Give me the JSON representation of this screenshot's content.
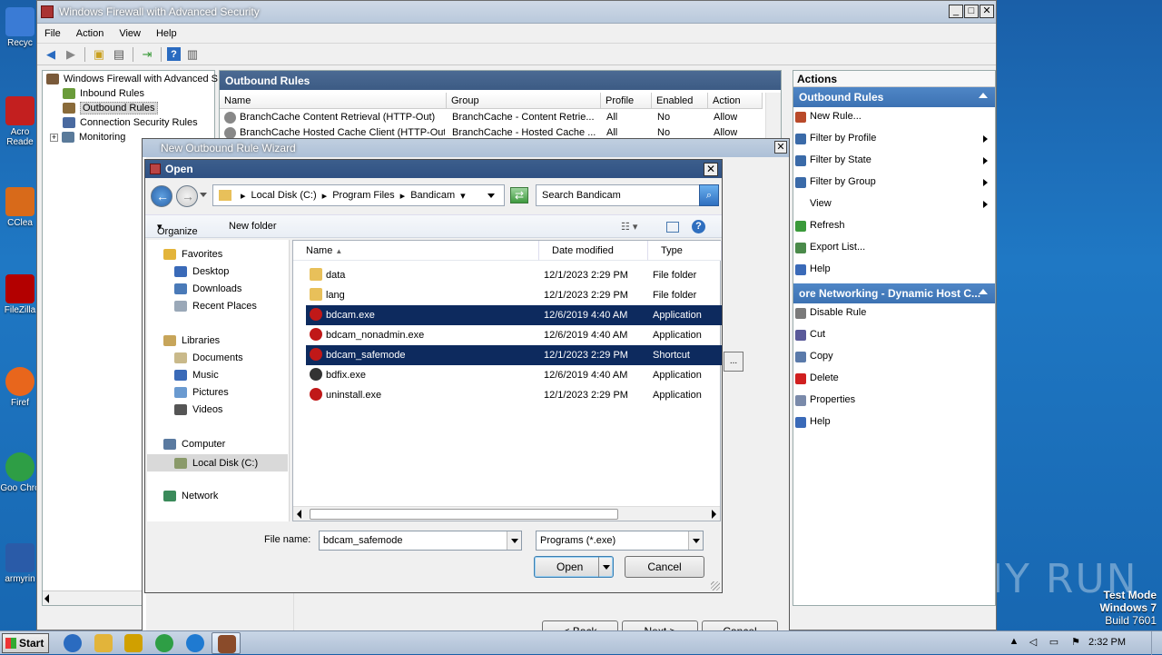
{
  "desktop": {
    "icons": [
      {
        "label": "Recyc",
        "color": "#3a7bd5"
      },
      {
        "label": "Acro Reade",
        "color": "#c31f1f"
      },
      {
        "label": "CClea",
        "color": "#d86a1a"
      },
      {
        "label": "FileZilla",
        "color": "#b30000"
      },
      {
        "label": "Firef",
        "color": "#e8661c"
      },
      {
        "label": "Goo Chro",
        "color": "#2e9e45"
      },
      {
        "label": "armyrin",
        "color": "#2a5ba8"
      }
    ],
    "watermark": "ANY RUN",
    "testmode": {
      "line1": "Test Mode",
      "line2": "Windows 7",
      "line3": "Build 7601"
    }
  },
  "mainwin": {
    "title": "Windows Firewall with Advanced Security",
    "menu": [
      "File",
      "Action",
      "View",
      "Help"
    ],
    "tree": [
      {
        "label": "Windows Firewall with Advanced S",
        "color": "#7a5a3a"
      },
      {
        "label": "Inbound Rules",
        "color": "#6a9b3a"
      },
      {
        "label": "Outbound Rules",
        "color": "#8a6b3a"
      },
      {
        "label": "Connection Security Rules",
        "color": "#4a6aa0"
      },
      {
        "label": "Monitoring",
        "color": "#5a7a9a"
      }
    ],
    "center": {
      "title": "Outbound Rules",
      "columns": [
        "Name",
        "Group",
        "Profile",
        "Enabled",
        "Action"
      ],
      "rows": [
        [
          "BranchCache Content Retrieval (HTTP-Out)",
          "BranchCache - Content Retrie...",
          "All",
          "No",
          "Allow"
        ],
        [
          "BranchCache Hosted Cache Client (HTTP-Out)",
          "BranchCache - Hosted Cache ...",
          "All",
          "No",
          "Allow"
        ]
      ]
    },
    "actions": {
      "title": "Actions",
      "section1": "Outbound Rules",
      "items1": [
        {
          "label": "New Rule...",
          "arrow": false,
          "color": "#b94a2a"
        },
        {
          "label": "Filter by Profile",
          "arrow": true,
          "color": "#3a6aa8"
        },
        {
          "label": "Filter by State",
          "arrow": true,
          "color": "#3a6aa8"
        },
        {
          "label": "Filter by Group",
          "arrow": true,
          "color": "#3a6aa8"
        },
        {
          "label": "View",
          "arrow": true,
          "color": "#ffffff"
        },
        {
          "label": "Refresh",
          "arrow": false,
          "color": "#3a9a3a"
        },
        {
          "label": "Export List...",
          "arrow": false,
          "color": "#4a8a4a"
        },
        {
          "label": "Help",
          "arrow": false,
          "color": "#3a6ab8"
        }
      ],
      "section2": "ore Networking - Dynamic Host C...",
      "items2": [
        {
          "label": "Disable Rule",
          "color": "#7a7a7a"
        },
        {
          "label": "Cut",
          "color": "#5a5a9a"
        },
        {
          "label": "Copy",
          "color": "#5a7aaa"
        },
        {
          "label": "Delete",
          "color": "#d02020"
        },
        {
          "label": "Properties",
          "color": "#7a8aaa"
        },
        {
          "label": "Help",
          "color": "#3a6ab8"
        }
      ]
    }
  },
  "wizard": {
    "title": "New Outbound Rule Wizard",
    "buttons": {
      "back": "< Back",
      "next": "Next >",
      "cancel": "Cancel"
    }
  },
  "open_dialog": {
    "title": "Open",
    "address": [
      "Local Disk (C:)",
      "Program Files",
      "Bandicam"
    ],
    "search_placeholder": "Search Bandicam",
    "commands": {
      "organize": "Organize",
      "new_folder": "New folder"
    },
    "nav": {
      "favorites": "Favorites",
      "fav_items": [
        "Desktop",
        "Downloads",
        "Recent Places"
      ],
      "libraries": "Libraries",
      "lib_items": [
        "Documents",
        "Music",
        "Pictures",
        "Videos"
      ],
      "computer": "Computer",
      "comp_items": [
        "Local Disk (C:)"
      ],
      "network": "Network"
    },
    "columns": {
      "name": "Name",
      "date": "Date modified",
      "type": "Type"
    },
    "files": [
      {
        "name": "data",
        "date": "12/1/2023 2:29 PM",
        "type": "File folder",
        "selected": false,
        "color": "#e8c05a"
      },
      {
        "name": "lang",
        "date": "12/1/2023 2:29 PM",
        "type": "File folder",
        "selected": false,
        "color": "#e8c05a"
      },
      {
        "name": "bdcam.exe",
        "date": "12/6/2019 4:40 AM",
        "type": "Application",
        "selected": true,
        "color": "#c01818"
      },
      {
        "name": "bdcam_nonadmin.exe",
        "date": "12/6/2019 4:40 AM",
        "type": "Application",
        "selected": false,
        "color": "#c01818"
      },
      {
        "name": "bdcam_safemode",
        "date": "12/1/2023 2:29 PM",
        "type": "Shortcut",
        "selected": true,
        "color": "#c01818"
      },
      {
        "name": "bdfix.exe",
        "date": "12/6/2019 4:40 AM",
        "type": "Application",
        "selected": false,
        "color": "#333333"
      },
      {
        "name": "uninstall.exe",
        "date": "12/1/2023 2:29 PM",
        "type": "Application",
        "selected": false,
        "color": "#c01818"
      }
    ],
    "filename_label": "File name:",
    "filename_value": "bdcam_safemode",
    "filter_value": "Programs (*.exe)",
    "open_label": "Open",
    "cancel_label": "Cancel"
  },
  "taskbar": {
    "start": "Start",
    "clock": "2:32 PM",
    "apps": [
      "#2a6bc0",
      "#e2b43a",
      "#d0a000",
      "#2e9e45",
      "#1f7ad1",
      "#8a4b2a"
    ]
  }
}
